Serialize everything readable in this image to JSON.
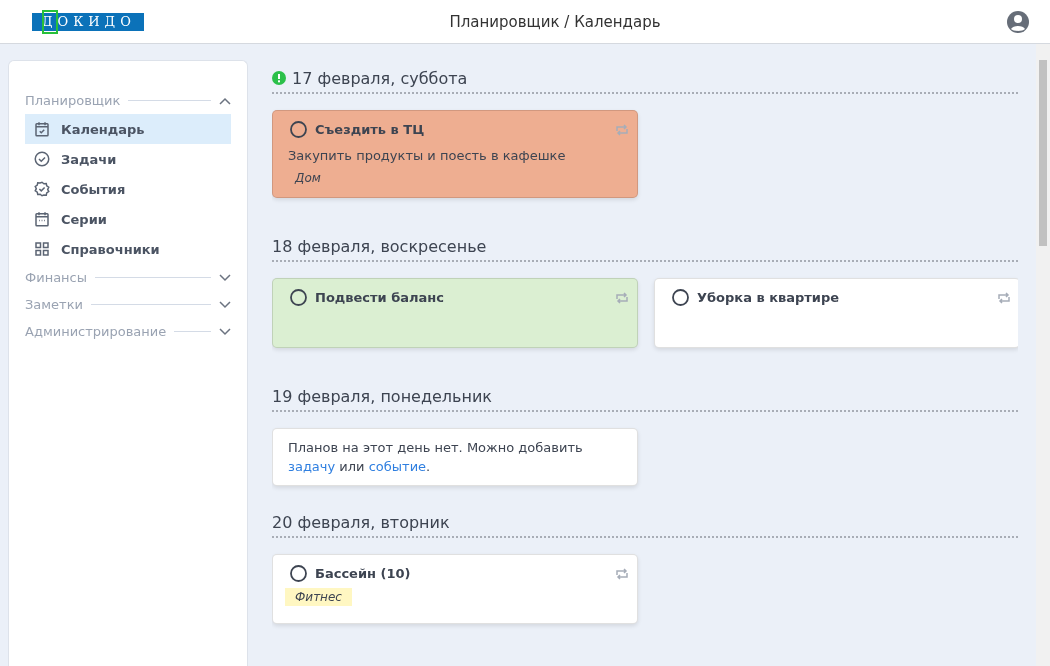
{
  "header": {
    "logo": "ДОКИДО",
    "title": "Планировщик / Календарь"
  },
  "sidebar": {
    "groups": [
      {
        "label": "Планировщик",
        "expanded": true,
        "items": [
          {
            "label": "Календарь",
            "selected": true
          },
          {
            "label": "Задачи",
            "selected": false
          },
          {
            "label": "События",
            "selected": false
          },
          {
            "label": "Серии",
            "selected": false
          },
          {
            "label": "Справочники",
            "selected": false
          }
        ]
      },
      {
        "label": "Финансы",
        "expanded": false
      },
      {
        "label": "Заметки",
        "expanded": false
      },
      {
        "label": "Администрирование",
        "expanded": false
      }
    ]
  },
  "days": [
    {
      "heading": "17 февраля, суббота",
      "alert": true,
      "cards": [
        {
          "title": "Съездить в ТЦ",
          "color": "#eeae91",
          "done": false,
          "description": "Закупить продукты и поесть в кафешке",
          "tag": {
            "label": "Дом"
          }
        }
      ]
    },
    {
      "heading": "18 февраля, воскресенье",
      "alert": false,
      "cards": [
        {
          "title": "Подвести баланс",
          "color": "#dbefd2",
          "done": false
        },
        {
          "title": "Уборка в квартире",
          "color": "#ffffff",
          "done": false
        }
      ]
    },
    {
      "heading": "19 февраля, понедельник",
      "alert": false,
      "empty": [
        {
          "kind": "text",
          "text": "Планов на этот день нет. Можно добавить "
        },
        {
          "kind": "link",
          "text": "задачу"
        },
        {
          "kind": "text",
          "text": " или "
        },
        {
          "kind": "link",
          "text": "событие"
        },
        {
          "kind": "text",
          "text": "."
        }
      ]
    },
    {
      "heading": "20 февраля, вторник",
      "alert": false,
      "cards": [
        {
          "title": "Бассейн (10)",
          "color": "#ffffff",
          "done": false,
          "tag": {
            "label": "Фитнес",
            "color": "#fff7c2"
          }
        }
      ]
    }
  ]
}
